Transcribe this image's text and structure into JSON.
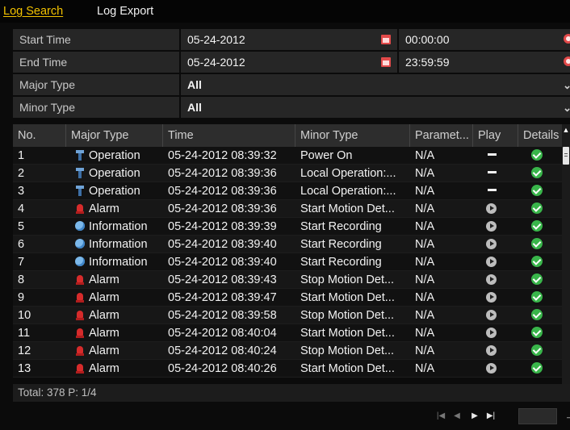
{
  "tabs": [
    {
      "label": "Log Search",
      "active": true
    },
    {
      "label": "Log Export",
      "active": false
    }
  ],
  "filters": {
    "start_time": {
      "label": "Start Time",
      "date": "05-24-2012",
      "time": "00:00:00"
    },
    "end_time": {
      "label": "End Time",
      "date": "05-24-2012",
      "time": "23:59:59"
    },
    "major_type": {
      "label": "Major Type",
      "value": "All"
    },
    "minor_type": {
      "label": "Minor Type",
      "value": "All"
    }
  },
  "table": {
    "columns": [
      "No.",
      "Major Type",
      "Time",
      "Minor Type",
      "Paramet...",
      "Play",
      "Details"
    ],
    "rows": [
      {
        "no": "1",
        "major": "Operation",
        "major_icon": "operation",
        "time": "05-24-2012 08:39:32",
        "minor": "Power On",
        "param": "N/A",
        "play": "dash"
      },
      {
        "no": "2",
        "major": "Operation",
        "major_icon": "operation",
        "time": "05-24-2012 08:39:36",
        "minor": "Local Operation:...",
        "param": "N/A",
        "play": "dash"
      },
      {
        "no": "3",
        "major": "Operation",
        "major_icon": "operation",
        "time": "05-24-2012 08:39:36",
        "minor": "Local Operation:...",
        "param": "N/A",
        "play": "dash"
      },
      {
        "no": "4",
        "major": "Alarm",
        "major_icon": "alarm",
        "time": "05-24-2012 08:39:36",
        "minor": "Start Motion Det...",
        "param": "N/A",
        "play": "play"
      },
      {
        "no": "5",
        "major": "Information",
        "major_icon": "information",
        "time": "05-24-2012 08:39:39",
        "minor": "Start Recording",
        "param": "N/A",
        "play": "play"
      },
      {
        "no": "6",
        "major": "Information",
        "major_icon": "information",
        "time": "05-24-2012 08:39:40",
        "minor": "Start Recording",
        "param": "N/A",
        "play": "play"
      },
      {
        "no": "7",
        "major": "Information",
        "major_icon": "information",
        "time": "05-24-2012 08:39:40",
        "minor": "Start Recording",
        "param": "N/A",
        "play": "play"
      },
      {
        "no": "8",
        "major": "Alarm",
        "major_icon": "alarm",
        "time": "05-24-2012 08:39:43",
        "minor": "Stop Motion Det...",
        "param": "N/A",
        "play": "play"
      },
      {
        "no": "9",
        "major": "Alarm",
        "major_icon": "alarm",
        "time": "05-24-2012 08:39:47",
        "minor": "Start Motion Det...",
        "param": "N/A",
        "play": "play"
      },
      {
        "no": "10",
        "major": "Alarm",
        "major_icon": "alarm",
        "time": "05-24-2012 08:39:58",
        "minor": "Stop Motion Det...",
        "param": "N/A",
        "play": "play"
      },
      {
        "no": "11",
        "major": "Alarm",
        "major_icon": "alarm",
        "time": "05-24-2012 08:40:04",
        "minor": "Start Motion Det...",
        "param": "N/A",
        "play": "play"
      },
      {
        "no": "12",
        "major": "Alarm",
        "major_icon": "alarm",
        "time": "05-24-2012 08:40:24",
        "minor": "Stop Motion Det...",
        "param": "N/A",
        "play": "play"
      },
      {
        "no": "13",
        "major": "Alarm",
        "major_icon": "alarm",
        "time": "05-24-2012 08:40:26",
        "minor": "Start Motion Det...",
        "param": "N/A",
        "play": "play"
      }
    ]
  },
  "footer": {
    "total": "Total: 378  P: 1/4",
    "page_input": ""
  },
  "colors": {
    "active_tab": "#f2c200",
    "details_check": "#39b54a",
    "alarm_icon": "#d62b2b",
    "info_icon": "#7bb8ea",
    "operation_icon": "#6fa3d7"
  },
  "icons": {
    "start_date": "calendar-icon",
    "start_time": "clock-icon",
    "dropdown": "chevron-down-icon",
    "play": "play-icon",
    "details": "check-circle-icon",
    "pager": [
      "first-page-icon",
      "prev-page-icon",
      "next-page-icon",
      "last-page-icon",
      "go-arrow-icon"
    ]
  }
}
